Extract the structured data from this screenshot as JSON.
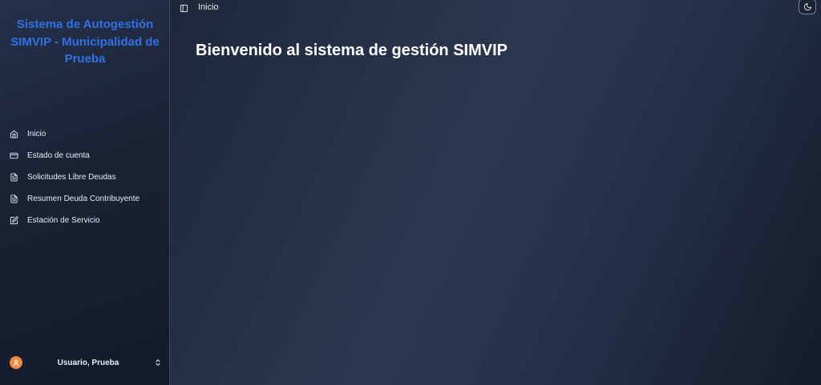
{
  "sidebar": {
    "brand": "Sistema de Autogestión SIMVIP - Municipalidad de Prueba",
    "items": [
      {
        "label": "Inicio",
        "icon": "home-icon"
      },
      {
        "label": "Estado de cuenta",
        "icon": "credit-card-icon"
      },
      {
        "label": "Solicitudes Libre Deudas",
        "icon": "file-text-icon"
      },
      {
        "label": "Resumen Deuda Contribuyente",
        "icon": "file-text-icon"
      },
      {
        "label": "Estación de Servicio",
        "icon": "edit-icon"
      }
    ],
    "user": {
      "name": "Usuario, Prueba",
      "avatar_color": "#f08a3c"
    }
  },
  "header": {
    "breadcrumb": "Inicio"
  },
  "main": {
    "title": "Bienvenido al sistema de gestión SIMVIP"
  },
  "colors": {
    "brand": "#2f72e8",
    "text": "#e8ecf4"
  }
}
